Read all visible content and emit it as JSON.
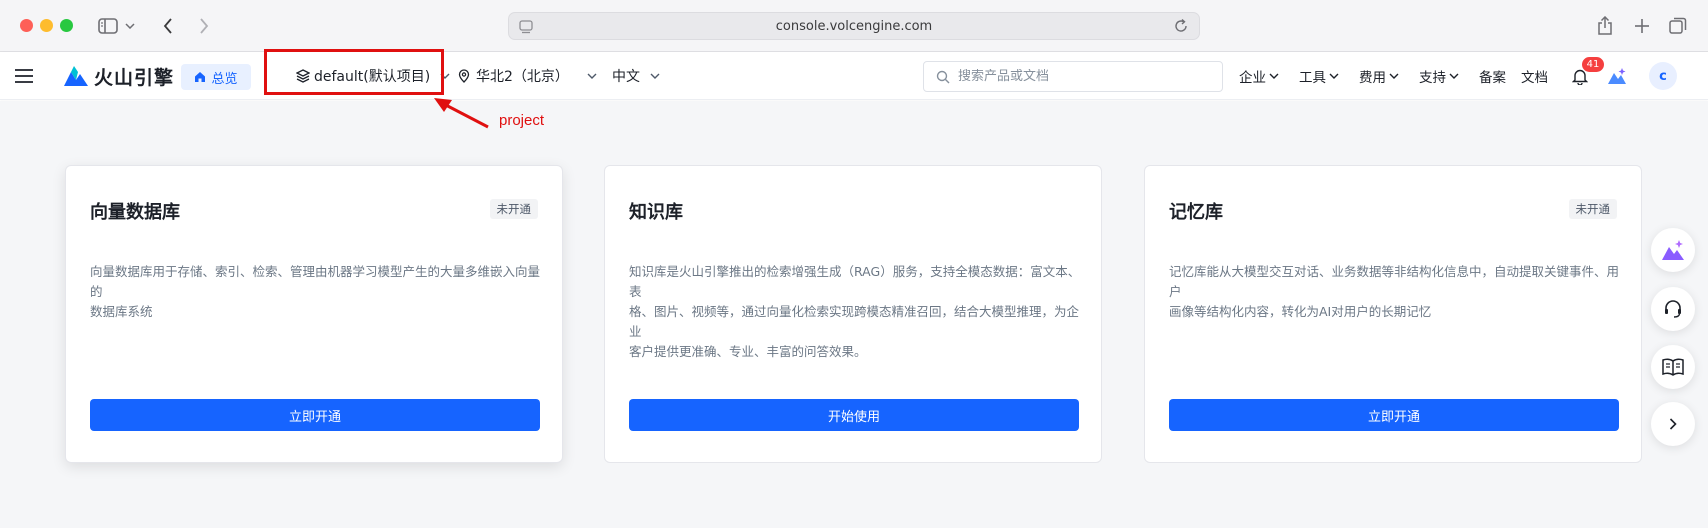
{
  "browser": {
    "url": "console.volcengine.com"
  },
  "header": {
    "logo_text": "火山引擎",
    "overview_label": "总览",
    "project_label": "default(默认项目)",
    "region_label": "华北2（北京）",
    "lang_label": "中文",
    "search_placeholder": "搜索产品或文档",
    "menu": [
      {
        "label": "企业"
      },
      {
        "label": "工具"
      },
      {
        "label": "费用"
      },
      {
        "label": "支持"
      },
      {
        "label": "备案"
      },
      {
        "label": "文档"
      }
    ],
    "notification_count": "41",
    "avatar_letter": "c"
  },
  "annotation": {
    "label": "project",
    "color": "#e01010"
  },
  "cards": [
    {
      "title": "向量数据库",
      "badge": "未开通",
      "desc_lines": [
        "向量数据库用于存储、索引、检索、管理由机器学习模型产生的大量多维嵌入向量的",
        "数据库系统"
      ],
      "button": "立即开通"
    },
    {
      "title": "知识库",
      "badge": "",
      "desc_lines": [
        "知识库是火山引擎推出的检索增强生成（RAG）服务，支持全模态数据：富文本、表",
        "格、图片、视频等，通过向量化检索实现跨模态精准召回，结合大模型推理，为企业",
        "客户提供更准确、专业、丰富的问答效果。"
      ],
      "button": "开始使用"
    },
    {
      "title": "记忆库",
      "badge": "未开通",
      "desc_lines": [
        "记忆库能从大模型交互对话、业务数据等非结构化信息中，自动提取关键事件、用户",
        "画像等结构化内容，转化为AI对用户的长期记忆"
      ],
      "button": "立即开通"
    }
  ],
  "colors": {
    "primary": "#1664ff",
    "badge_red": "#f53f3f"
  }
}
